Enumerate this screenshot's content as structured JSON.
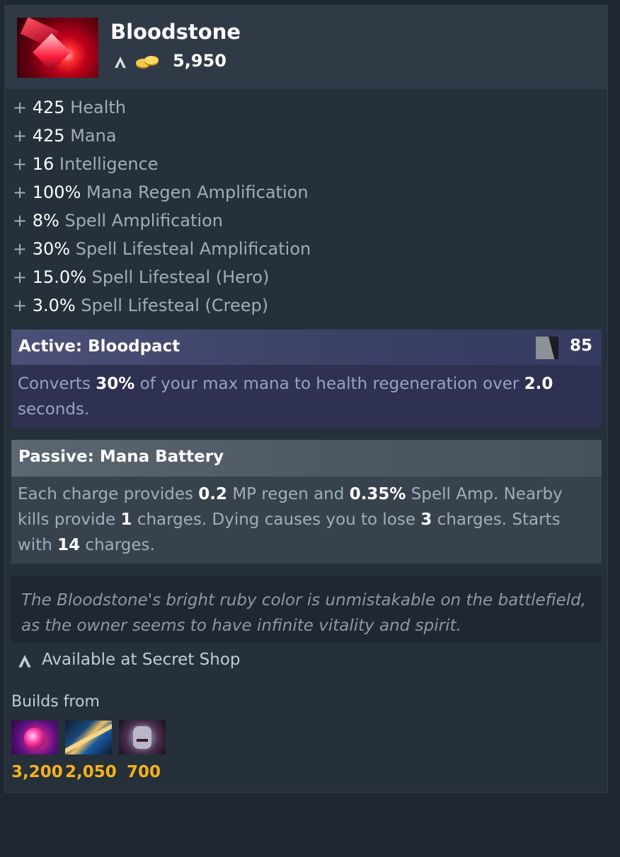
{
  "item": {
    "name": "Bloodstone",
    "cost": "5,950",
    "icon": "bloodstone-icon"
  },
  "stats": [
    {
      "plus": "+",
      "value": "425",
      "label": " Health"
    },
    {
      "plus": "+",
      "value": "425",
      "label": " Mana"
    },
    {
      "plus": "+",
      "value": "16",
      "label": " Intelligence"
    },
    {
      "plus": "+",
      "value": "100%",
      "label": " Mana Regen Amplification"
    },
    {
      "plus": "+",
      "value": "8%",
      "label": " Spell Amplification"
    },
    {
      "plus": "+",
      "value": "30%",
      "label": " Spell Lifesteal Amplification"
    },
    {
      "plus": "+",
      "value": "15.0%",
      "label": " Spell Lifesteal (Hero)"
    },
    {
      "plus": "+",
      "value": "3.0%",
      "label": " Spell Lifesteal (Creep)"
    }
  ],
  "active": {
    "title": "Active: Bloodpact",
    "cooldown": "85",
    "desc_1": "Converts ",
    "b1": "30%",
    "desc_2": " of your max mana to health regeneration over ",
    "b2": "2.0",
    "desc_3": " seconds."
  },
  "passive": {
    "title": "Passive: Mana Battery",
    "d1": "Each charge provides ",
    "b1": "0.2",
    "d2": " MP regen and ",
    "b2": "0.35%",
    "d3": " Spell Amp. Nearby kills provide ",
    "b3": "1",
    "d4": " charges. Dying causes you to lose ",
    "b4": "3",
    "d5": " charges. Starts with ",
    "b5": "14",
    "d6": " charges."
  },
  "lore": "The Bloodstone's bright ruby color is unmistakable on the battlefield, as the owner seems to have infinite vitality and spirit.",
  "secret_shop": "Available at Secret Shop",
  "builds": {
    "label": "Builds from",
    "components": [
      {
        "icon": "component-1-icon",
        "cost": "3,200"
      },
      {
        "icon": "component-2-icon",
        "cost": "2,050"
      },
      {
        "icon": "component-3-icon",
        "cost": "700"
      }
    ]
  },
  "colors": {
    "gold": "#f5b21b",
    "active_bg": "#2e3151",
    "passive_bg": "#37424d"
  }
}
